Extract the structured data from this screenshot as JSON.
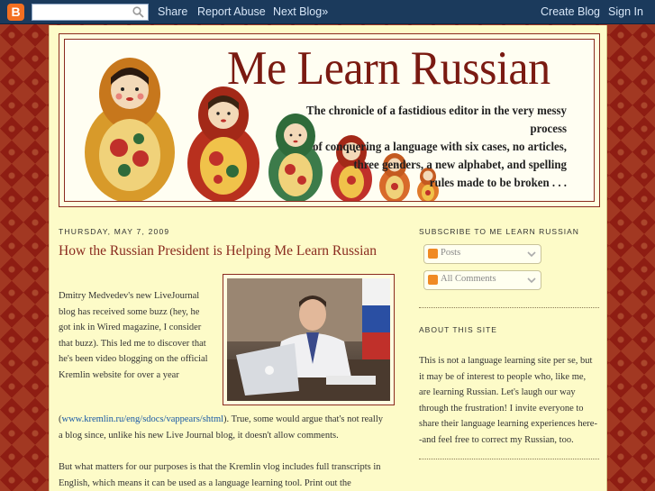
{
  "navbar": {
    "logo": "B",
    "search_value": "",
    "links": [
      "Share",
      "Report Abuse",
      "Next Blog»"
    ],
    "create_blog": "Create Blog",
    "sign_in": "Sign In"
  },
  "header": {
    "title": "Me Learn Russian",
    "description": [
      "The chronicle of a fastidious editor in the very messy process",
      "of conquering a language with six cases, no articles,",
      "three genders, a new alphabet, and spelling",
      "rules made to be broken . . ."
    ]
  },
  "post": {
    "date": "Thursday, May 7, 2009",
    "title": "How the Russian President is Helping Me Learn Russian",
    "para1_lines": [
      "Dmitry Medvedev's new LiveJournal",
      "blog has received some buzz (hey, he",
      "got ink in Wired magazine, I consider",
      "that buzz). This led me to discover that",
      "he's been video blogging on the official",
      "Kremlin website for over a year"
    ],
    "para2_open": "(",
    "para2_link": "www.kremlin.ru/eng/sdocs/vappears/shtml",
    "para2_rest": "). True, some would argue that's not really",
    "para2_line2": "a blog since, unlike his new Live Journal blog, it doesn't allow comments.",
    "para3_lines": [
      "But what matters for our purposes is that the Kremlin vlog includes full transcripts in",
      "English, which means it can be used as a language learning tool. Print out the"
    ]
  },
  "sidebar": {
    "subscribe_heading": "Subscribe to Me Learn Russian",
    "feed_posts": "Posts",
    "feed_comments": "All Comments",
    "about_heading": "About This Site",
    "about_lines": [
      "This is not a language learning site per se, but",
      "it may be of interest to people who, like me,",
      "are learning Russian. Let's laugh our way",
      "through the frustration! I invite everyone to",
      "share their language learning experiences here-",
      "-and feel free to correct my Russian, too."
    ]
  },
  "colors": {
    "background": "#8e1d13",
    "page": "#fdfbc8",
    "title_red": "#8a2b1f",
    "navbar": "#1b3a5c",
    "link": "#1a5aa6"
  }
}
